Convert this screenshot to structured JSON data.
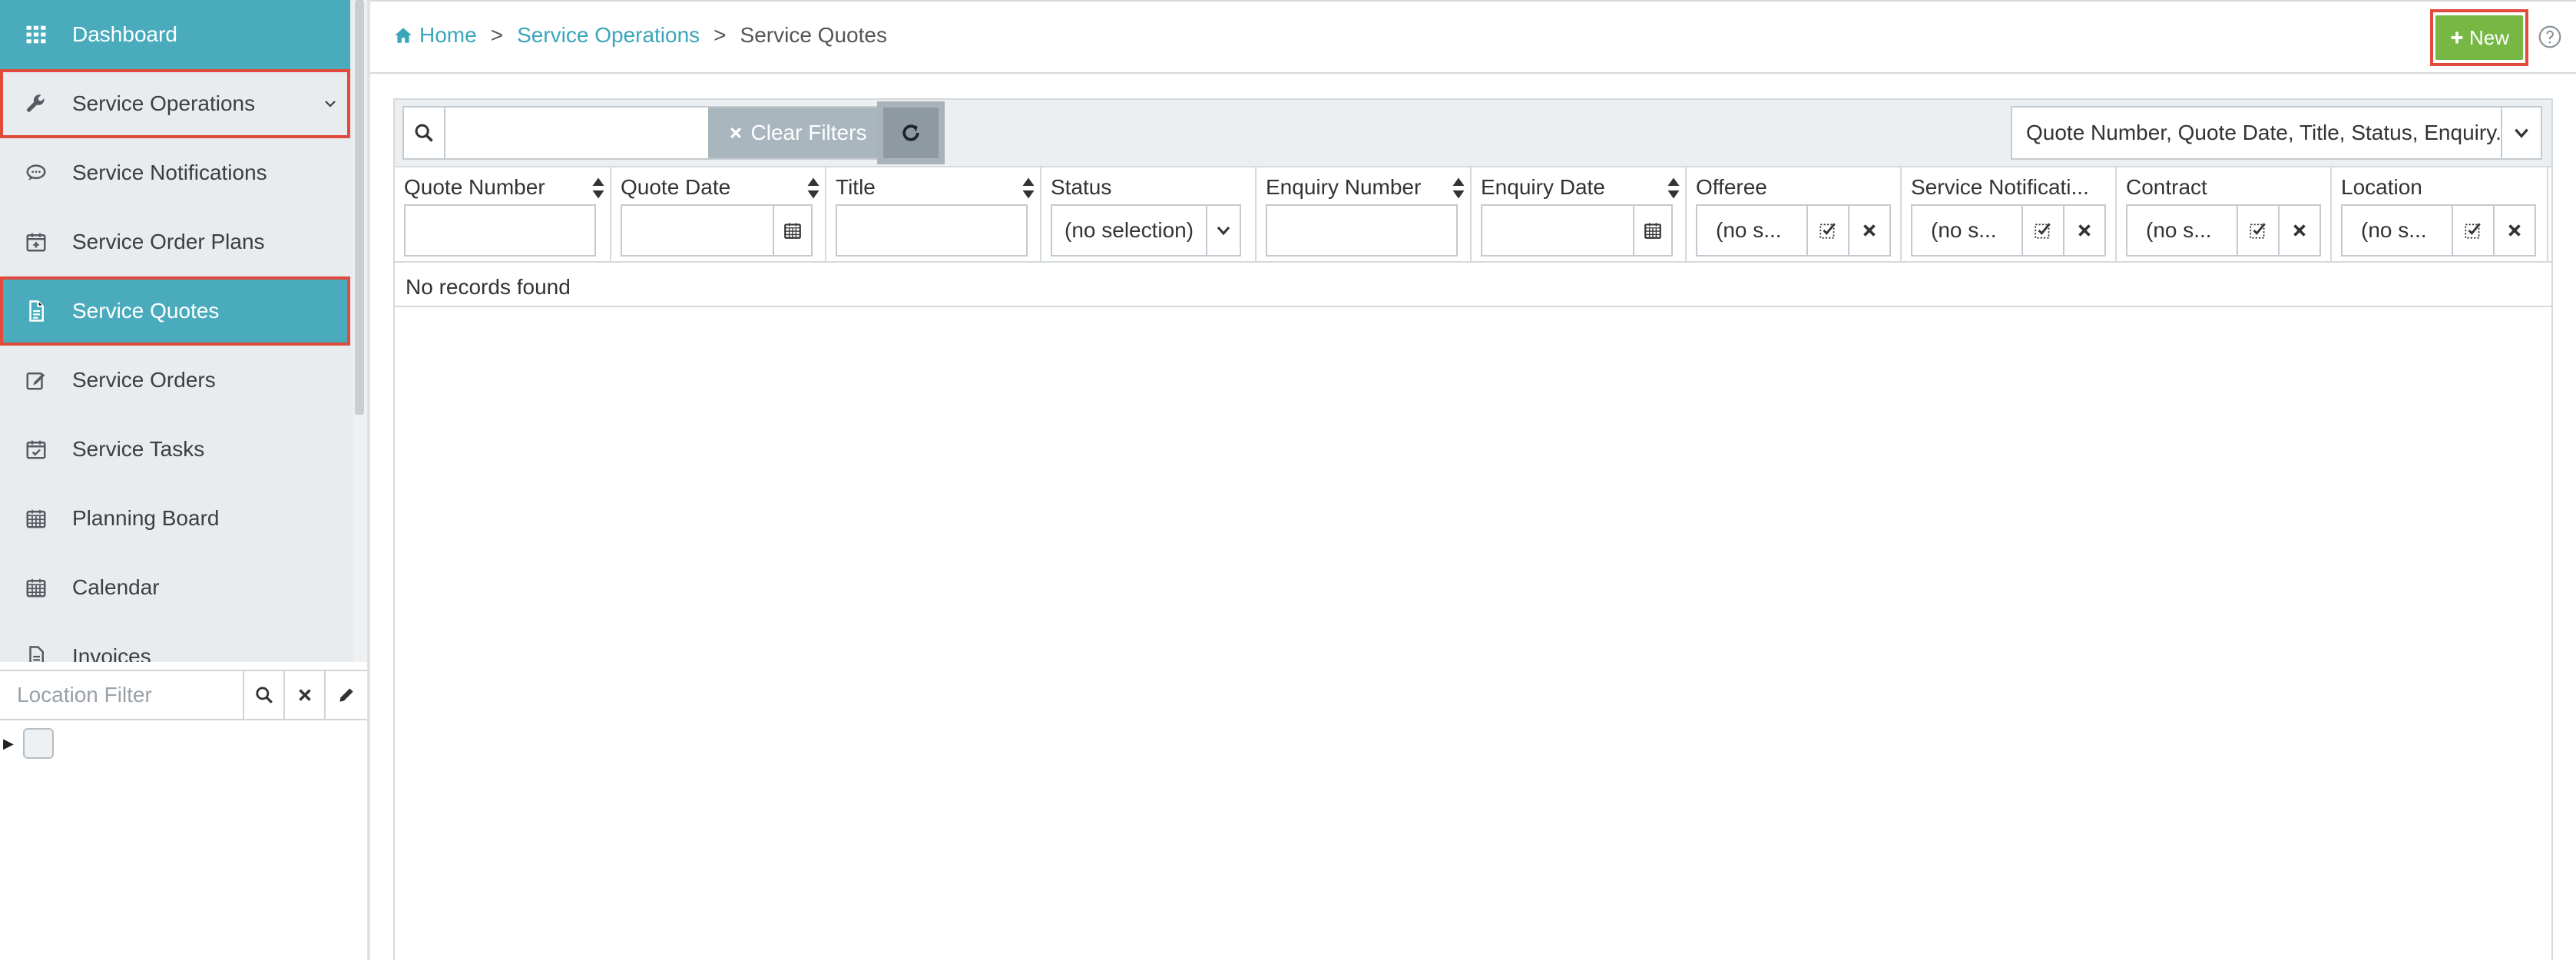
{
  "sidebar": {
    "items": [
      {
        "label": "Dashboard",
        "icon": "grid-icon"
      },
      {
        "label": "Service Operations",
        "icon": "wrench-icon"
      },
      {
        "label": "Service Notifications",
        "icon": "speech-bubble-icon"
      },
      {
        "label": "Service Order Plans",
        "icon": "calendar-plus-icon"
      },
      {
        "label": "Service Quotes",
        "icon": "document-icon"
      },
      {
        "label": "Service Orders",
        "icon": "edit-icon"
      },
      {
        "label": "Service Tasks",
        "icon": "calendar-check-icon"
      },
      {
        "label": "Planning Board",
        "icon": "calendar-icon"
      },
      {
        "label": "Calendar",
        "icon": "calendar-icon"
      },
      {
        "label": "Invoices",
        "icon": "document-icon"
      }
    ],
    "location_filter": {
      "placeholder": "Location Filter"
    }
  },
  "header": {
    "breadcrumb": {
      "home": "Home",
      "section": "Service Operations",
      "current": "Service Quotes",
      "separator": ">"
    },
    "new_label": "New"
  },
  "toolbar": {
    "clear_filters_label": "Clear Filters",
    "columns_label": "Quote Number, Quote Date, Title, Status, Enquiry..."
  },
  "columns": {
    "quote_number": "Quote Number",
    "quote_date": "Quote Date",
    "title": "Title",
    "status": "Status",
    "enquiry_number": "Enquiry Number",
    "enquiry_date": "Enquiry Date",
    "offeree": "Offeree",
    "service_notification": "Service Notificati...",
    "contract": "Contract",
    "location": "Location"
  },
  "filters": {
    "status_value": "(no selection)",
    "offeree_value": "(no s...",
    "service_notification_value": "(no s...",
    "contract_value": "(no s...",
    "location_value": "(no s..."
  },
  "empty_message": "No records found",
  "colors": {
    "accent": "#4aabbd",
    "highlight": "#e14b3b",
    "new_button": "#77b744",
    "link": "#3aa6b9"
  }
}
